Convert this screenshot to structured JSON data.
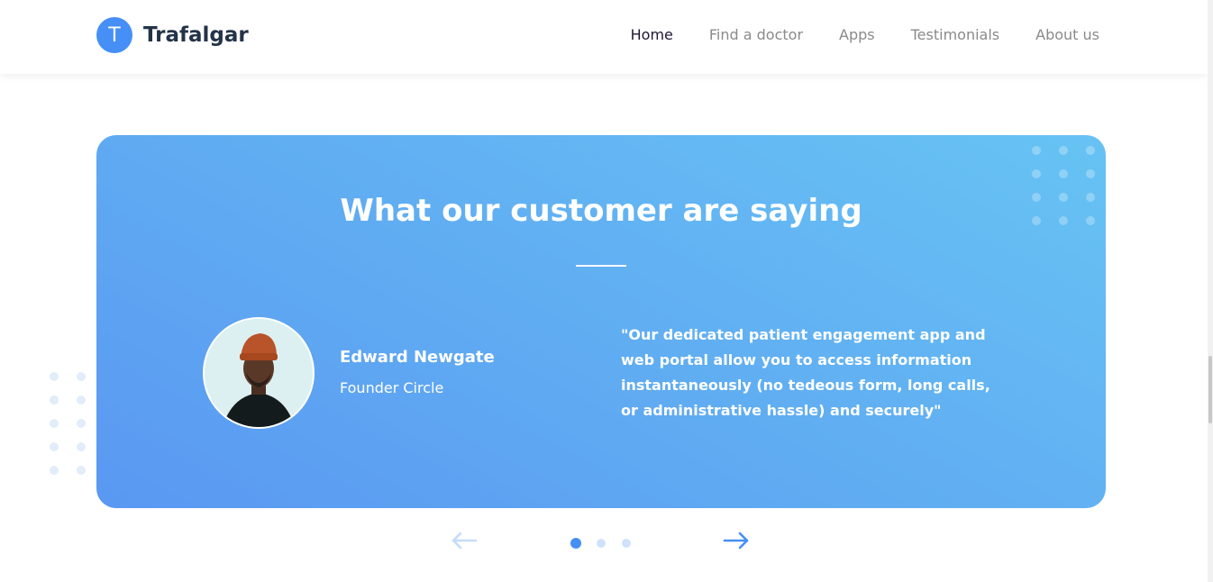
{
  "brand": {
    "logo_letter": "T",
    "name": "Trafalgar",
    "accent": "#458ff6"
  },
  "nav": {
    "items": [
      {
        "label": "Home",
        "active": true
      },
      {
        "label": "Find a doctor",
        "active": false
      },
      {
        "label": "Apps",
        "active": false
      },
      {
        "label": "Testimonials",
        "active": false
      },
      {
        "label": "About us",
        "active": false
      }
    ]
  },
  "testimonials": {
    "title": "What our customer are saying",
    "gradient": [
      "#67c3f3",
      "#5a98f2"
    ],
    "current": {
      "name": "Edward Newgate",
      "role": "Founder Circle",
      "quote": "\"Our dedicated patient engagement app and web portal allow you to access information instantaneously (no tedeous form, long calls, or administrative hassle) and securely\"",
      "avatar_icon": "person-portrait-icon"
    },
    "pagination": {
      "active_index": 1,
      "total": 3
    },
    "prev_icon": "arrow-left-icon",
    "next_icon": "arrow-right-icon"
  }
}
